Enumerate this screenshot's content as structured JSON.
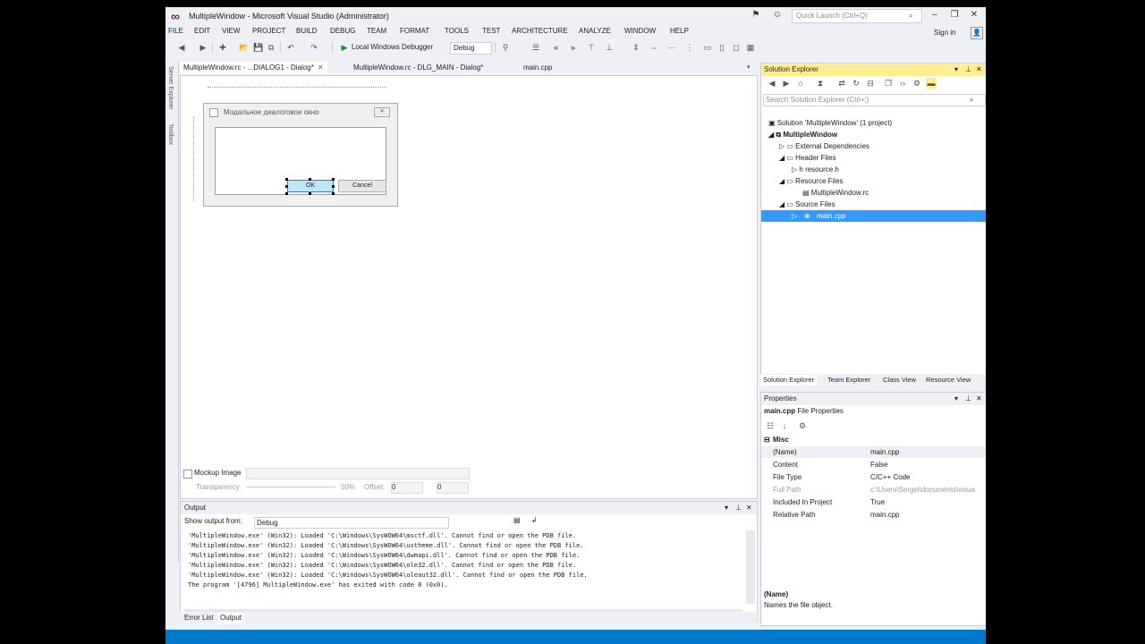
{
  "window": {
    "title": "MultipleWindow - Microsoft Visual Studio (Administrator)",
    "quick_launch_placeholder": "Quick Launch (Ctrl+Q)",
    "sign_in": "Sign in"
  },
  "menu": [
    "FILE",
    "EDIT",
    "VIEW",
    "PROJECT",
    "BUILD",
    "DEBUG",
    "TEAM",
    "FORMAT",
    "TOOLS",
    "TEST",
    "ARCHITECTURE",
    "ANALYZE",
    "WINDOW",
    "HELP"
  ],
  "toolbar": {
    "run_label": "Local Windows Debugger",
    "config": "Debug"
  },
  "left_strip": [
    "Server Explorer",
    "Toolbox"
  ],
  "doc_tabs": [
    {
      "label": "MultipleWindow.rc - ...DIALOG1 - Dialog*",
      "active": true
    },
    {
      "label": "MultipleWindow.rc - DLG_MAIN - Dialog*",
      "active": false
    },
    {
      "label": "main.cpp",
      "active": false
    }
  ],
  "dialog": {
    "title": "Модальное диалоговое окно",
    "ok": "OK",
    "cancel": "Cancel"
  },
  "mockup": {
    "label": "Mockup Image",
    "transparency_label": "Transparency",
    "percent": "50%",
    "offset_label": "Offset",
    "offset_x": "0",
    "offset_y": "0"
  },
  "output": {
    "header": "Output",
    "show_from_label": "Show output from:",
    "show_from_value": "Debug",
    "lines": [
      "'MultipleWindow.exe' (Win32): Loaded 'C:\\Windows\\SysWOW64\\msctf.dll'. Cannot find or open the PDB file.",
      "'MultipleWindow.exe' (Win32): Loaded 'C:\\Windows\\SysWOW64\\uxtheme.dll'. Cannot find or open the PDB file.",
      "'MultipleWindow.exe' (Win32): Loaded 'C:\\Windows\\SysWOW64\\dwmapi.dll'. Cannot find or open the PDB file.",
      "'MultipleWindow.exe' (Win32): Loaded 'C:\\Windows\\SysWOW64\\ole32.dll'. Cannot find or open the PDB file.",
      "'MultipleWindow.exe' (Win32): Loaded 'C:\\Windows\\SysWOW64\\oleaut32.dll'. Cannot find or open the PDB file.",
      "The program '[4796] MultipleWindow.exe' has exited with code 0 (0x0)."
    ]
  },
  "bottom_tabs": [
    {
      "label": "Error List",
      "active": false
    },
    {
      "label": "Output",
      "active": true
    }
  ],
  "solution_explorer": {
    "header": "Solution Explorer",
    "search_placeholder": "Search Solution Explorer (Ctrl+;)",
    "nodes": [
      {
        "label": "Solution 'MultipleWindow' (1 project)",
        "indent": 0,
        "arrow": ""
      },
      {
        "label": "MultipleWindow",
        "indent": 1,
        "arrow": "◢",
        "bold": true
      },
      {
        "label": "External Dependencies",
        "indent": 2,
        "arrow": "▷"
      },
      {
        "label": "Header Files",
        "indent": 2,
        "arrow": "◢"
      },
      {
        "label": "resource.h",
        "indent": 3,
        "arrow": "▷"
      },
      {
        "label": "Resource Files",
        "indent": 2,
        "arrow": "◢"
      },
      {
        "label": "MultipleWindow.rc",
        "indent": 3,
        "arrow": ""
      },
      {
        "label": "Source Files",
        "indent": 2,
        "arrow": "◢"
      },
      {
        "label": "main.cpp",
        "indent": 3,
        "arrow": "▷",
        "selected": true
      }
    ],
    "tabs": [
      {
        "label": "Solution Explorer",
        "active": true
      },
      {
        "label": "Team Explorer",
        "active": false
      },
      {
        "label": "Class View",
        "active": false
      },
      {
        "label": "Resource View",
        "active": false
      }
    ]
  },
  "properties": {
    "header": "Properties",
    "object": "main.cpp",
    "object_type": "File Properties",
    "category": "Misc",
    "rows": [
      {
        "name": "(Name)",
        "value": "main.cpp"
      },
      {
        "name": "Content",
        "value": "False"
      },
      {
        "name": "File Type",
        "value": "C/C++ Code"
      },
      {
        "name": "Full Path",
        "value": "c:\\Users\\Sergei\\documents\\visua",
        "dim": true
      },
      {
        "name": "Included In Project",
        "value": "True"
      },
      {
        "name": "Relative Path",
        "value": "main.cpp"
      }
    ],
    "desc_title": "(Name)",
    "desc_text": "Names the file object."
  },
  "colors": {
    "accent": "#007acc",
    "selection": "#3399ff",
    "active_header": "#ffef91",
    "vs_purple": "#68217a"
  }
}
